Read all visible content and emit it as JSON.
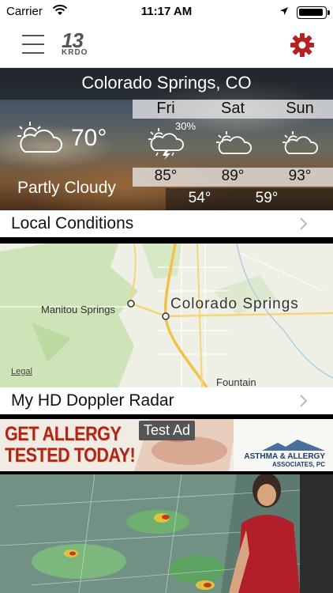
{
  "status_bar": {
    "carrier": "Carrier",
    "time": "11:17 AM"
  },
  "header": {
    "logo_number": "13",
    "logo_call": "KRDO"
  },
  "weather": {
    "city": "Colorado Springs, CO",
    "current": {
      "temp": "70°",
      "condition": "Partly Cloudy",
      "icon": "partly-cloudy-icon"
    },
    "forecast": [
      {
        "day": "Fri",
        "icon": "thunderstorm-icon",
        "precip": "30%",
        "high": "85°",
        "low": "54°"
      },
      {
        "day": "Sat",
        "icon": "partly-cloudy-icon",
        "high": "89°",
        "low": "59°"
      },
      {
        "day": "Sun",
        "icon": "partly-cloudy-icon",
        "high": "93°"
      }
    ]
  },
  "local_conditions": {
    "label": "Local Conditions"
  },
  "map": {
    "labels": {
      "manitou": "Manitou Springs",
      "springs": "Colorado Springs",
      "fountain": "Fountain"
    },
    "legal": "Legal"
  },
  "radar": {
    "label": "My HD Doppler Radar"
  },
  "ad": {
    "line1": "GET ALLERGY",
    "line2": "TESTED TODAY!",
    "badge": "Test Ad",
    "brand_line1": "ASTHMA & ALLERGY",
    "brand_line2": "ASSOCIATES, PC"
  },
  "colors": {
    "accent": "#b22222",
    "ad_text": "#b0241b",
    "road": "#f1c24b"
  }
}
